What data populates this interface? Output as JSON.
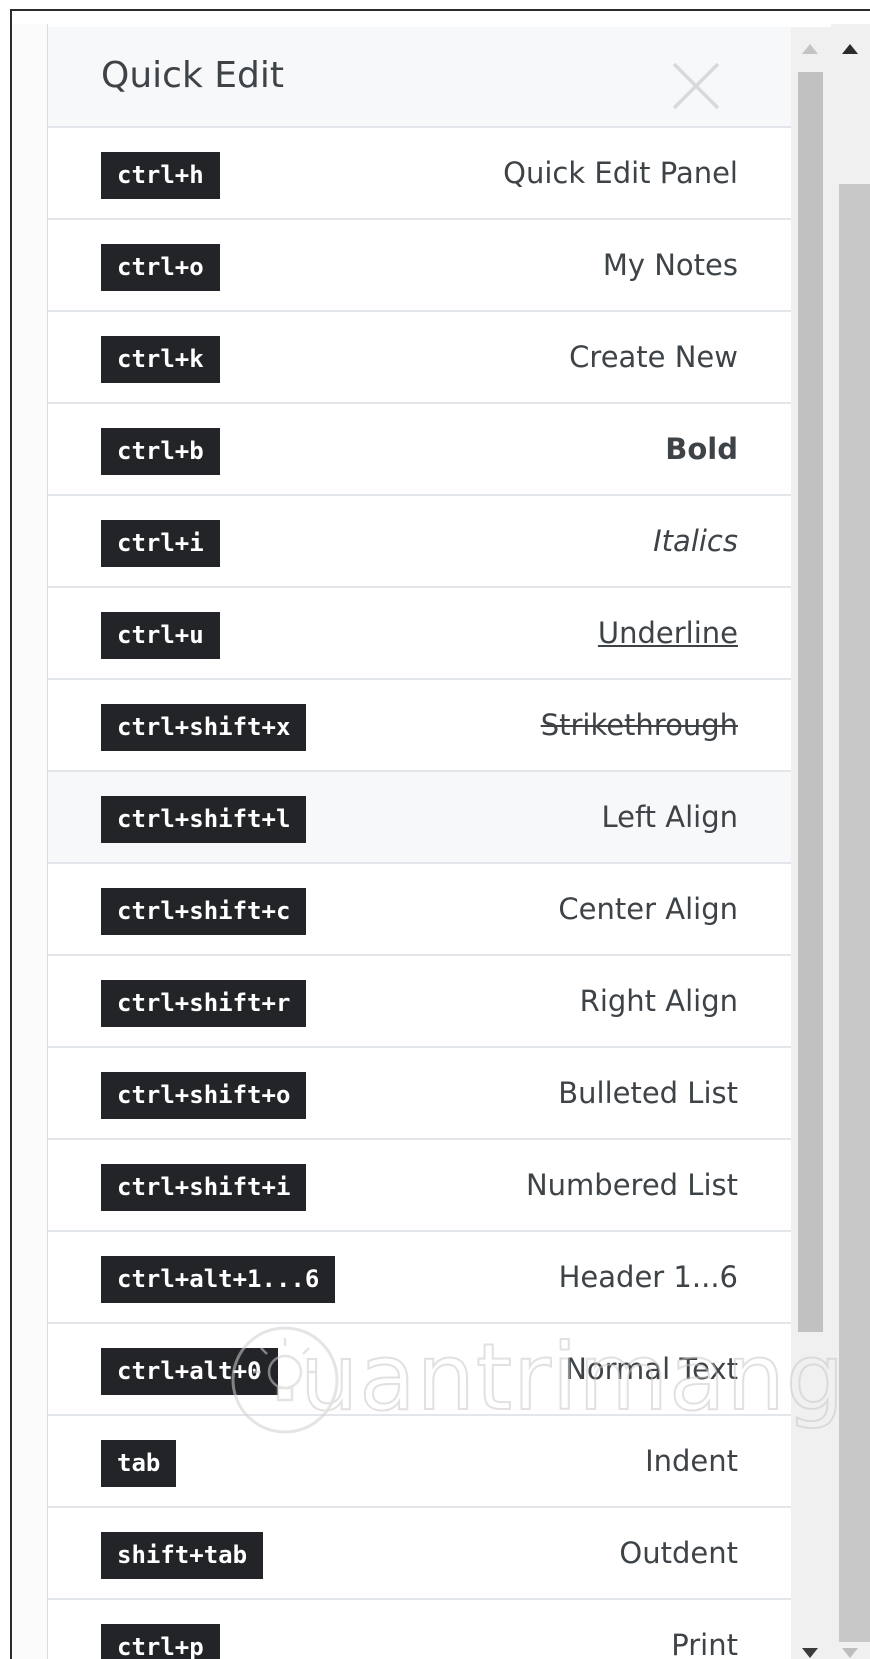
{
  "panel": {
    "title": "Quick Edit",
    "close_icon": "close-icon"
  },
  "shortcuts": [
    {
      "key": "ctrl+h",
      "action": "Quick Edit Panel",
      "style": "normal"
    },
    {
      "key": "ctrl+o",
      "action": "My Notes",
      "style": "normal"
    },
    {
      "key": "ctrl+k",
      "action": "Create New",
      "style": "normal"
    },
    {
      "key": "ctrl+b",
      "action": "Bold",
      "style": "bold"
    },
    {
      "key": "ctrl+i",
      "action": "Italics",
      "style": "italic"
    },
    {
      "key": "ctrl+u",
      "action": "Underline",
      "style": "underline"
    },
    {
      "key": "ctrl+shift+x",
      "action": "Strikethrough",
      "style": "strike"
    },
    {
      "key": "ctrl+shift+l",
      "action": "Left Align",
      "style": "normal",
      "highlighted": true
    },
    {
      "key": "ctrl+shift+c",
      "action": "Center Align",
      "style": "normal"
    },
    {
      "key": "ctrl+shift+r",
      "action": "Right Align",
      "style": "normal"
    },
    {
      "key": "ctrl+shift+o",
      "action": "Bulleted List",
      "style": "normal"
    },
    {
      "key": "ctrl+shift+i",
      "action": "Numbered List",
      "style": "normal"
    },
    {
      "key": "ctrl+alt+1...6",
      "action": "Header 1...6",
      "style": "normal"
    },
    {
      "key": "ctrl+alt+0",
      "action": "Normal Text",
      "style": "normal"
    },
    {
      "key": "tab",
      "action": "Indent",
      "style": "normal"
    },
    {
      "key": "shift+tab",
      "action": "Outdent",
      "style": "normal"
    },
    {
      "key": "ctrl+p",
      "action": "Print",
      "style": "normal"
    }
  ],
  "watermark": {
    "text": "uantrimang",
    "icon": "lightbulb-logo-icon"
  },
  "colors": {
    "key_badge_bg": "#222427",
    "key_badge_text": "#ffffff",
    "header_bg": "#f6f8fa",
    "row_border": "#e3e6ea",
    "text": "#3e4347"
  }
}
